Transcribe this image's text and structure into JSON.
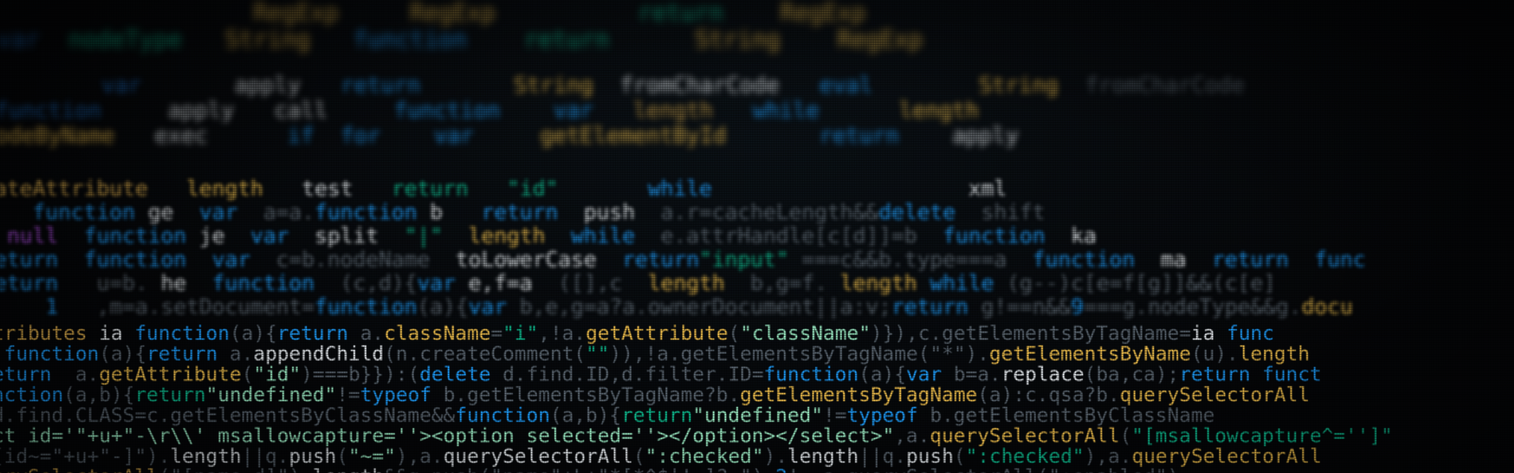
{
  "photo": {
    "subject": "code-screen",
    "bands": [
      {
        "name": "far",
        "lines": [
          [
            [
              "                    ",
              "gray"
            ],
            [
              "RegExp",
              "yellow"
            ],
            [
              "     ",
              "gray"
            ],
            [
              "RegExp",
              "yellow"
            ],
            [
              "          ",
              "gray"
            ],
            [
              "return",
              "teal"
            ],
            [
              "    ",
              "gray"
            ],
            [
              "RegExp",
              "yellow"
            ]
          ],
          [
            [
              "  ",
              "gray"
            ],
            [
              "var",
              "blued"
            ],
            [
              "  ",
              "gray"
            ],
            [
              "nodeType",
              "teal"
            ],
            [
              "   ",
              "gray"
            ],
            [
              "String",
              "yellow"
            ],
            [
              "   ",
              "gray"
            ],
            [
              "function",
              "blue"
            ],
            [
              "    ",
              "gray"
            ],
            [
              "return",
              "teal"
            ],
            [
              "      ",
              "gray"
            ],
            [
              "String",
              "yellow"
            ],
            [
              "    ",
              "gray"
            ],
            [
              "RegExp",
              "yellow"
            ]
          ]
        ]
      },
      {
        "name": "mid-far",
        "lines": [
          [
            [
              "          ",
              "gray"
            ],
            [
              "var",
              "blued"
            ],
            [
              "       ",
              "gray"
            ],
            [
              "apply",
              "white"
            ],
            [
              "   ",
              "gray"
            ],
            [
              "return",
              "blue"
            ],
            [
              "       ",
              "gray"
            ],
            [
              "String",
              "yellow"
            ],
            [
              "  ",
              "gray"
            ],
            [
              "fromCharCode",
              "white"
            ],
            [
              "   ",
              "gray"
            ],
            [
              "eval",
              "blue"
            ],
            [
              "        ",
              "gray"
            ],
            [
              "String",
              "yellow"
            ],
            [
              "  ",
              "gray"
            ],
            [
              "fromCharCode",
              "gray"
            ]
          ],
          [
            [
              "  ",
              "gray"
            ],
            [
              "function",
              "blued"
            ],
            [
              "     ",
              "gray"
            ],
            [
              "apply",
              "white"
            ],
            [
              "   ",
              "gray"
            ],
            [
              "call",
              "white"
            ],
            [
              "     ",
              "gray"
            ],
            [
              "function",
              "blue"
            ],
            [
              "    ",
              "gray"
            ],
            [
              "var",
              "blue"
            ],
            [
              "   ",
              "gray"
            ],
            [
              "length",
              "yellowd"
            ],
            [
              "   ",
              "gray"
            ],
            [
              "while",
              "blue"
            ],
            [
              "      ",
              "gray"
            ],
            [
              "length",
              "yellow"
            ]
          ],
          [
            [
              "sNodeByName",
              "yellow"
            ],
            [
              "   ",
              "gray"
            ],
            [
              "exec",
              "white"
            ],
            [
              "      ",
              "gray"
            ],
            [
              "if",
              "blue"
            ],
            [
              "  ",
              "gray"
            ],
            [
              "for",
              "blue"
            ],
            [
              "    ",
              "gray"
            ],
            [
              "var",
              "blue"
            ],
            [
              "     ",
              "gray"
            ],
            [
              "getElementById",
              "yellow"
            ],
            [
              "       ",
              "gray"
            ],
            [
              "return",
              "blue"
            ],
            [
              "    ",
              "gray"
            ],
            [
              "apply",
              "white"
            ]
          ]
        ]
      },
      {
        "name": "mid",
        "lines": [
          [
            [
              "reateAttribute",
              "yellowd"
            ],
            [
              "   ",
              "gray"
            ],
            [
              "length",
              "yellow"
            ],
            [
              "   ",
              "gray"
            ],
            [
              "test",
              "white"
            ],
            [
              "   ",
              "gray"
            ],
            [
              "return",
              "teal"
            ],
            [
              "   ",
              "gray"
            ],
            [
              "\"id\"",
              "teal"
            ],
            [
              "       ",
              "gray"
            ],
            [
              "while",
              "blue"
            ],
            [
              "                    ",
              "gray"
            ],
            [
              "xml",
              "white"
            ]
          ],
          [
            [
              "     ",
              "gray"
            ],
            [
              "function",
              "blue"
            ],
            [
              " ge ",
              "white"
            ],
            [
              " var ",
              "blue"
            ],
            [
              " a=a.",
              "gray"
            ],
            [
              "function",
              "blue"
            ],
            [
              " b  ",
              "white"
            ],
            [
              " return ",
              "blue"
            ],
            [
              " push ",
              "white"
            ],
            [
              " a.r=cacheLength&&",
              "gray"
            ],
            [
              "delete",
              "blue"
            ],
            [
              "  shift",
              "gray"
            ]
          ],
          [
            [
              "   ",
              "gray"
            ],
            [
              "null",
              "purple"
            ],
            [
              "  ",
              "gray"
            ],
            [
              "function",
              "blue"
            ],
            [
              " je ",
              "white"
            ],
            [
              " var ",
              "blue"
            ],
            [
              " split ",
              "white"
            ],
            [
              " \"|\" ",
              "teal"
            ],
            [
              " length ",
              "yellow"
            ],
            [
              " while ",
              "blue"
            ],
            [
              " e.attrHandle[c[d]]=b ",
              "gray"
            ],
            [
              " function ",
              "blue"
            ],
            [
              " ka",
              "white"
            ]
          ],
          [
            [
              " return ",
              "blue"
            ],
            [
              " function ",
              "blue"
            ],
            [
              " var ",
              "blue"
            ],
            [
              " c=b.nodeName ",
              "gray"
            ],
            [
              " toLowerCase ",
              "white"
            ],
            [
              " return",
              "blue"
            ],
            [
              "\"input\"",
              "teal"
            ],
            [
              " ===c&&b.type===a ",
              "gray"
            ],
            [
              " function ",
              "blue"
            ],
            [
              " ma ",
              "white"
            ],
            [
              " return ",
              "blue"
            ],
            [
              " func",
              "blue"
            ]
          ],
          [
            [
              " return ",
              "blue"
            ],
            [
              "  u=b.",
              "gray"
            ],
            [
              " he ",
              "white"
            ],
            [
              " function ",
              "blue"
            ],
            [
              " (c,d){",
              "gray"
            ],
            [
              "var",
              "blue"
            ],
            [
              " e,f=a ",
              "white"
            ],
            [
              " ([],c ",
              "gray"
            ],
            [
              " length ",
              "yellow"
            ],
            [
              " b,g=f. ",
              "gray"
            ],
            [
              "length",
              "yellow"
            ],
            [
              " while",
              "blue"
            ],
            [
              " (g--)c[e=f[g]]&&(c[e]",
              "gray"
            ]
          ],
          [
            [
              "      ",
              "gray"
            ],
            [
              "1",
              "blue"
            ],
            [
              "   ,m=a.setDocument=",
              "gray"
            ],
            [
              "function",
              "blue"
            ],
            [
              "(a){",
              "gray"
            ],
            [
              "var",
              "blue"
            ],
            [
              " b,e,g=a?a.ownerDocument||a:v;",
              "gray"
            ],
            [
              "return",
              "blue"
            ],
            [
              " g!==n&&",
              "gray"
            ],
            [
              "9",
              "blue"
            ],
            [
              "===g.nodeType&&g.",
              "gray"
            ],
            [
              "docu",
              "yellow"
            ]
          ]
        ]
      },
      {
        "name": "near",
        "lines": [
          [
            [
              "attributes",
              "yellowd"
            ],
            [
              " ia ",
              "white"
            ],
            [
              "function",
              "blue"
            ],
            [
              "(a){",
              "gray"
            ],
            [
              "return",
              "blue"
            ],
            [
              " a.",
              "gray"
            ],
            [
              "className",
              "yellow"
            ],
            [
              "=",
              "gray"
            ],
            [
              "\"i\"",
              "teal"
            ],
            [
              ",!a.",
              "gray"
            ],
            [
              "getAttribute",
              "yellow"
            ],
            [
              "(",
              "gray"
            ],
            [
              "\"className\"",
              "mint"
            ],
            [
              ")}),c.getElementsByTagName=",
              "gray"
            ],
            [
              "ia",
              "white"
            ],
            [
              " func",
              "blue"
            ]
          ],
          [
            [
              "ia ",
              "yellowd"
            ],
            [
              "function",
              "blue"
            ],
            [
              "(a){",
              "gray"
            ],
            [
              "return",
              "blue"
            ],
            [
              " a.",
              "gray"
            ],
            [
              "appendChild",
              "white"
            ],
            [
              "(n.",
              "gray"
            ],
            [
              "createComment",
              "gray"
            ],
            [
              "(",
              "gray"
            ],
            [
              "\"\"",
              "teal"
            ],
            [
              ")),!a.getElementsByTagName(\"*\").",
              "gray"
            ],
            [
              "getElementsByName",
              "yellow"
            ],
            [
              "(u).",
              "gray"
            ],
            [
              "length",
              "yellow"
            ]
          ],
          [
            [
              " return ",
              "blue"
            ],
            [
              " a.",
              "gray"
            ],
            [
              "getAttribute",
              "yellow"
            ],
            [
              "(",
              "gray"
            ],
            [
              "\"id\"",
              "mint"
            ],
            [
              ")===b}}):(",
              "gray"
            ],
            [
              "delete",
              "blue"
            ],
            [
              " d.find.ID,d.filter.ID=",
              "gray"
            ],
            [
              "function",
              "blue"
            ],
            [
              "(a){",
              "gray"
            ],
            [
              "var",
              "blue"
            ],
            [
              " b=a.",
              "gray"
            ],
            [
              "replace",
              "white"
            ],
            [
              "(ba,ca);",
              "gray"
            ],
            [
              "return",
              "blue"
            ],
            [
              " funct",
              "blue"
            ]
          ],
          [
            [
              "function",
              "blue"
            ],
            [
              "(a,b){",
              "gray"
            ],
            [
              "return",
              "teal"
            ],
            [
              "\"undefined\"",
              "mint"
            ],
            [
              "!=",
              "gray"
            ],
            [
              "typeof",
              "blue"
            ],
            [
              " b.getElementsByTagName?b.",
              "gray"
            ],
            [
              "getElementsByTagName",
              "yellow"
            ],
            [
              "(a):c.qsa?b.",
              "gray"
            ],
            [
              "querySelectorAll",
              "yellow"
            ]
          ],
          [
            [
              "  d.find.CLASS=c.getElementsByClassName&&",
              "gray"
            ],
            [
              "function",
              "blue"
            ],
            [
              "(a,b){",
              "gray"
            ],
            [
              "return",
              "teal"
            ],
            [
              "\"undefined\"",
              "mint"
            ],
            [
              "!=",
              "gray"
            ],
            [
              "typeof",
              "blue"
            ],
            [
              " b.getElementsByClassName",
              "gray"
            ]
          ],
          [
            [
              "lect id='\"+u+\"-\\r\\\\' msallowcapture=''><option selected=''></option></select>\"",
              "mint"
            ],
            [
              ",a.",
              "gray"
            ],
            [
              "querySelectorAll",
              "yellow"
            ],
            [
              "(",
              "gray"
            ],
            [
              "\"[msallowcapture^='']\"",
              "teal"
            ]
          ],
          [
            [
              " \"[id~=\"+u+\"-]\").",
              "gray"
            ],
            [
              "length",
              "white"
            ],
            [
              "||q.",
              "gray"
            ],
            [
              "push",
              "white"
            ],
            [
              "(",
              "gray"
            ],
            [
              "\"~=\"",
              "mint"
            ],
            [
              "),a.",
              "gray"
            ],
            [
              "querySelectorAll",
              "white"
            ],
            [
              "(",
              "gray"
            ],
            [
              "\":checked\"",
              "mint"
            ],
            [
              ").",
              "gray"
            ],
            [
              "length",
              "white"
            ],
            [
              "||q.",
              "gray"
            ],
            [
              "push",
              "white"
            ],
            [
              "(",
              "gray"
            ],
            [
              "\":checked\"",
              "teal"
            ],
            [
              "),a.",
              "gray"
            ],
            [
              "querySelectorAll",
              "yellow"
            ]
          ],
          [
            [
              "querySelectorAll",
              "yellowd"
            ],
            [
              "(\"[name=d]\").",
              "gray"
            ],
            [
              "length",
              "white"
            ],
            [
              "&&q.push(\"name\"+L+\"*[*^$|!~]?=\"),",
              "gray"
            ],
            [
              "2",
              "blue"
            ],
            [
              "!==a.querySelectorAll(\":enabled\")",
              "gray"
            ]
          ]
        ]
      }
    ]
  }
}
